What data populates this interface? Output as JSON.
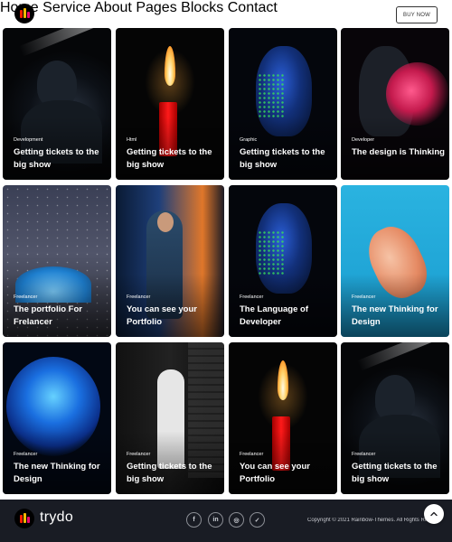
{
  "header": {
    "brand_colors": [
      "#f81f01",
      "#f8b901",
      "#ee076e"
    ],
    "nav": [
      "Home",
      "Service",
      "About",
      "Pages",
      "Blocks",
      "Contact"
    ],
    "cta_label": "BUY NOW"
  },
  "portfolio": {
    "cards": [
      {
        "category": "Development",
        "title": "Getting tickets to the big show",
        "image": "hooded-figure"
      },
      {
        "category": "Html",
        "title": "Getting tickets to the big show",
        "image": "red-candle"
      },
      {
        "category": "Graphic",
        "title": "Getting tickets to the big show",
        "image": "neon-face"
      },
      {
        "category": "Developer",
        "title": "The design is Thinking",
        "image": "pink-smoke"
      },
      {
        "category": "Freelancer",
        "title": "The portfolio For Frelancer",
        "image": "night-tent"
      },
      {
        "category": "Freelancer",
        "title": "You can see your Portfolio",
        "image": "neon-street"
      },
      {
        "category": "Freelancer",
        "title": "The Language of Developer",
        "image": "neon-face"
      },
      {
        "category": "Freelancer",
        "title": "The new Thinking for Design",
        "image": "hand-cyan"
      },
      {
        "category": "Freelancer",
        "title": "The new Thinking for Design",
        "image": "jellyfish"
      },
      {
        "category": "Freelancer",
        "title": "Getting tickets to the big show",
        "image": "bw-figure"
      },
      {
        "category": "Freelancer",
        "title": "You can see your Portfolio",
        "image": "red-candle"
      },
      {
        "category": "Freelancer",
        "title": "Getting tickets to the big show",
        "image": "hooded-figure"
      }
    ]
  },
  "footer": {
    "brand": "trydo",
    "social": [
      {
        "name": "facebook-icon",
        "glyph": "f"
      },
      {
        "name": "linkedin-icon",
        "glyph": "in"
      },
      {
        "name": "instagram-icon",
        "glyph": "◎"
      },
      {
        "name": "twitter-icon",
        "glyph": "✓"
      }
    ],
    "copyright": "Copyright © 2021 Rainbow-Themes. All Rights Reserved."
  }
}
